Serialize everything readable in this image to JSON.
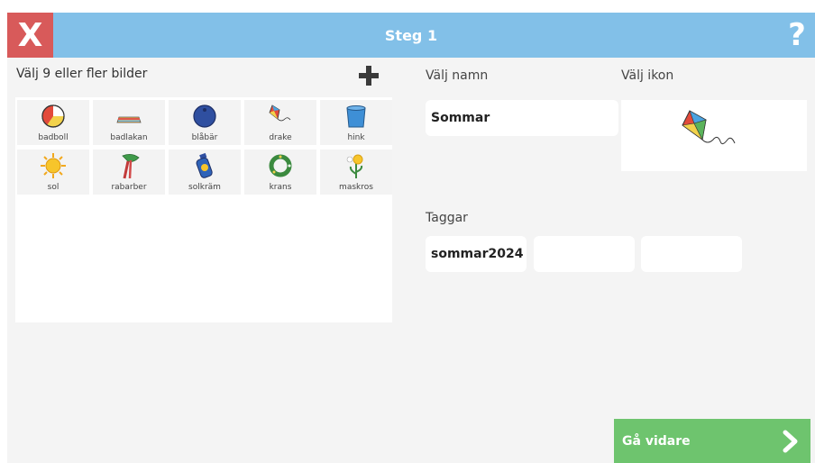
{
  "header": {
    "close_label": "X",
    "title": "Steg 1",
    "help_label": "?"
  },
  "left": {
    "label": "Välj 9 eller fler bilder",
    "add_icon": "plus-icon",
    "images": [
      {
        "label": "badboll",
        "icon": "beach-ball-icon"
      },
      {
        "label": "badlakan",
        "icon": "towel-icon"
      },
      {
        "label": "blåbär",
        "icon": "blueberry-icon"
      },
      {
        "label": "drake",
        "icon": "kite-icon"
      },
      {
        "label": "hink",
        "icon": "bucket-icon"
      },
      {
        "label": "sol",
        "icon": "sun-icon"
      },
      {
        "label": "rabarber",
        "icon": "rhubarb-icon"
      },
      {
        "label": "solkräm",
        "icon": "sunscreen-icon"
      },
      {
        "label": "krans",
        "icon": "wreath-icon"
      },
      {
        "label": "maskros",
        "icon": "dandelion-icon"
      }
    ]
  },
  "name_field": {
    "label": "Välj namn",
    "value": "Sommar"
  },
  "icon_field": {
    "label": "Välj ikon",
    "icon": "kite-icon"
  },
  "tags": {
    "label": "Taggar",
    "values": [
      "sommar2024",
      "",
      ""
    ]
  },
  "next_button": {
    "label": "Gå vidare",
    "icon": "chevron-right-icon"
  },
  "colors": {
    "header": "#82c0e8",
    "close": "#d85a5a",
    "next": "#6ec46e",
    "background": "#f4f4f4"
  }
}
